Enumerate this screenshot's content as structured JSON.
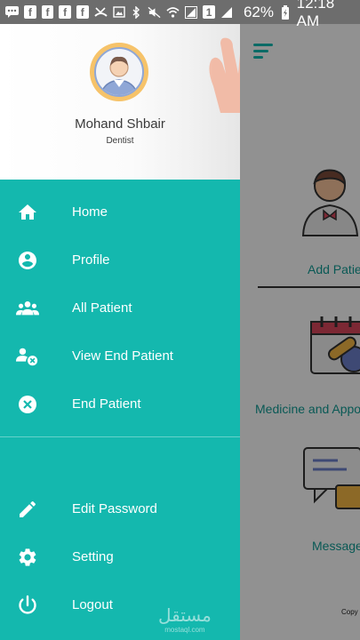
{
  "status_bar": {
    "icons": [
      "message-icon",
      "facebook-icon",
      "facebook-icon",
      "facebook-icon",
      "facebook-icon",
      "missed-call-icon",
      "image-icon",
      "bluetooth-icon",
      "mute-icon",
      "wifi-icon",
      "signal-1-icon",
      "sim-icon",
      "signal-icon",
      "battery-icon"
    ],
    "battery": "62%",
    "time": "12:18 AM"
  },
  "drawer": {
    "user_name": "Mohand Shbair",
    "user_role": "Dentist",
    "items": [
      {
        "label": "Home",
        "icon": "home-icon"
      },
      {
        "label": "Profile",
        "icon": "profile-icon"
      },
      {
        "label": "All Patient",
        "icon": "group-icon"
      },
      {
        "label": "View End Patient",
        "icon": "person-remove-icon"
      },
      {
        "label": "End Patient",
        "icon": "cancel-icon"
      },
      {
        "label": "Edit Password",
        "icon": "pencil-icon"
      },
      {
        "label": "Setting",
        "icon": "gear-icon"
      },
      {
        "label": "Logout",
        "icon": "power-icon"
      }
    ]
  },
  "background": {
    "cards": [
      {
        "label": "Add Patie"
      },
      {
        "label": "Medicine and Appoi"
      },
      {
        "label": "Message"
      }
    ],
    "footer": "Copy"
  },
  "watermark": {
    "arabic": "مستقل",
    "latin": "mostaql.com"
  },
  "colors": {
    "accent": "#14b8ae",
    "status_bar": "#6d6d6d",
    "text_dark": "#3a3a3a"
  }
}
